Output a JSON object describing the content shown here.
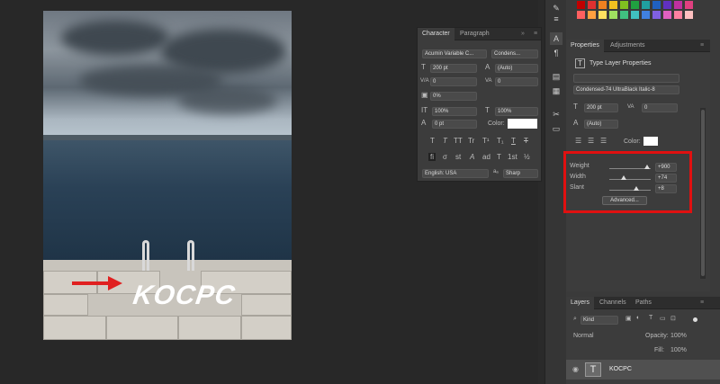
{
  "character_panel": {
    "tabs": [
      "Character",
      "Paragraph"
    ],
    "font_family": "Acumin Variable C...",
    "font_style": "Condens...",
    "font_size": "200 pt",
    "leading": "(Auto)",
    "kerning_label": "V/A",
    "kerning": "0",
    "tracking_label": "VA",
    "tracking": "0",
    "scale_tsume": "0%",
    "vertical_scale": "100%",
    "horizontal_scale": "100%",
    "baseline_shift": "0 pt",
    "color_label": "Color:",
    "text_styles": [
      "T",
      "T",
      "TT",
      "Tr",
      "T¹",
      "T₁",
      "T",
      "T"
    ],
    "opentype": [
      "fi",
      "σ",
      "st",
      "A",
      "ad",
      "T",
      "1st",
      "½"
    ],
    "language": "English: USA",
    "aa_label": "aₐ",
    "antialias": "Sharp"
  },
  "canvas": {
    "overlay_text": "KOCPC"
  },
  "properties_panel": {
    "tabs": [
      "Properties",
      "Adjustments"
    ],
    "section_title": "Type Layer Properties",
    "font_style": "Condensed-74 UltraBlack Italic-8",
    "font_size": "200 pt",
    "tracking": "0",
    "leading": "(Auto)",
    "color_label": "Color:",
    "variable_font": {
      "weight_label": "Weight",
      "weight_value": "+900",
      "weight_level": 0.92,
      "width_label": "Width",
      "width_value": "+74",
      "width_level": 0.35,
      "slant_label": "Slant",
      "slant_value": "+8",
      "slant_level": 0.65,
      "advanced_label": "Advanced..."
    }
  },
  "layers_panel": {
    "tabs": [
      "Layers",
      "Channels",
      "Paths"
    ],
    "filter": "Kind",
    "blend_mode": "Normal",
    "opacity_label": "Opacity:",
    "opacity": "100%",
    "fill_label": "Fill:",
    "fill": "100%",
    "layer_name": "KOCPC"
  },
  "colors": {
    "annotation_red": "#e01010",
    "panel_bg": "#3c3c3c",
    "app_bg": "#282828"
  }
}
